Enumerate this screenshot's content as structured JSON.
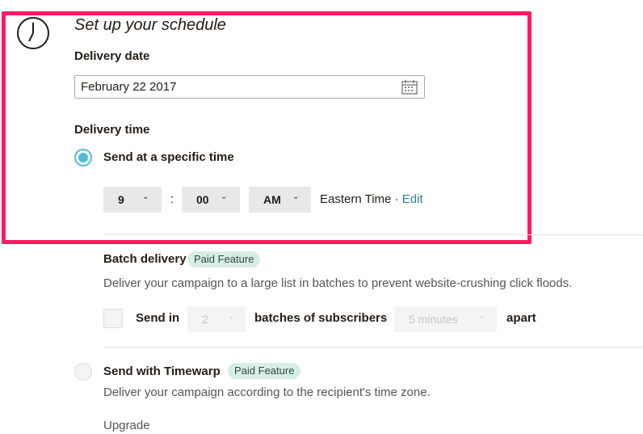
{
  "schedule": {
    "title": "Set up your schedule",
    "delivery_date_label": "Delivery date",
    "delivery_date_value": "February 22 2017",
    "delivery_time_label": "Delivery time",
    "specific_time_option": "Send at a specific time",
    "hour": "9",
    "colon": ":",
    "minute": "00",
    "ampm": "AM",
    "timezone": "Eastern Time",
    "separator": " · ",
    "edit_link": "Edit"
  },
  "batch": {
    "title": "Batch delivery",
    "badge": "Paid Feature",
    "description": "Deliver your campaign to a large list in batches to prevent website-crushing click floods.",
    "send_in": "Send in",
    "batches_value": "2",
    "batches_of": "batches of subscribers",
    "interval_value": "5 minutes",
    "apart": "apart"
  },
  "timewarp": {
    "title": "Send with Timewarp",
    "badge": "Paid Feature",
    "description": "Deliver your campaign according to the recipient's time zone.",
    "upgrade_link": "Upgrade"
  },
  "colors": {
    "highlight": "#ff1a62",
    "radio_selected": "#52bad5",
    "link": "#2f7fa3",
    "badge_bg": "#d8eee5"
  },
  "icons": [
    "clock-icon",
    "calendar-icon",
    "chevron-down-icon"
  ]
}
